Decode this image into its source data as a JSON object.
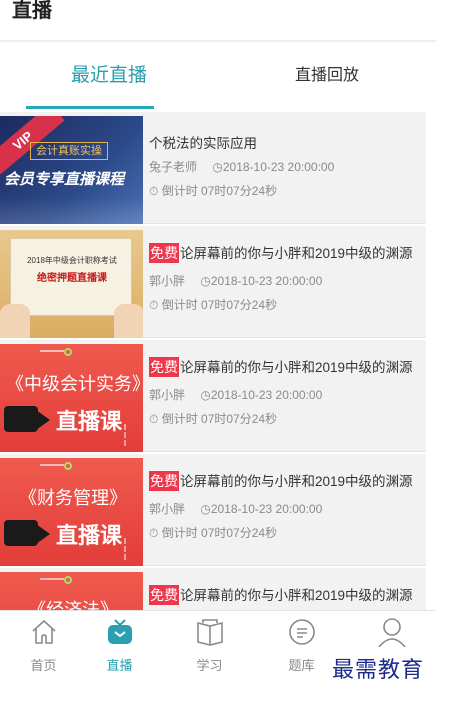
{
  "header": {
    "title": "直播"
  },
  "tabs": [
    {
      "label": "最近直播",
      "active": true
    },
    {
      "label": "直播回放",
      "active": false
    }
  ],
  "colors": {
    "accent": "#2aa7b8",
    "free_tag": "#f0364a",
    "watermark": "#1a2a8c"
  },
  "courses": [
    {
      "thumbnail": {
        "ribbon": "VIP",
        "subtitle": "会计真账实操",
        "headline": "会员专享直播课程"
      },
      "free": false,
      "title": "个税法的实际应用",
      "teacher": "兔子老师",
      "time": "2018-10-23 20:00:00",
      "countdown": "倒计时 07时07分24秒"
    },
    {
      "thumbnail": {
        "line1": "2018年中级会计职称考试",
        "line2": "绝密押题直播课"
      },
      "free": true,
      "free_label": "免费",
      "title": "论屏幕前的你与小胖和2019中级的渊源",
      "teacher": "郭小胖",
      "time": "2018-10-23 20:00:00",
      "countdown": "倒计时 07时07分24秒"
    },
    {
      "thumbnail": {
        "line1": "《中级会计实务》",
        "line2": "直播课"
      },
      "free": true,
      "free_label": "免费",
      "title": "论屏幕前的你与小胖和2019中级的渊源",
      "teacher": "郭小胖",
      "time": "2018-10-23 20:00:00",
      "countdown": "倒计时 07时07分24秒"
    },
    {
      "thumbnail": {
        "line1": "《财务管理》",
        "line2": "直播课"
      },
      "free": true,
      "free_label": "免费",
      "title": "论屏幕前的你与小胖和2019中级的渊源",
      "teacher": "郭小胖",
      "time": "2018-10-23 20:00:00",
      "countdown": "倒计时 07时07分24秒"
    },
    {
      "thumbnail": {
        "line1": "《经济法》",
        "line2": ""
      },
      "free": true,
      "free_label": "免费",
      "title": "论屏幕前的你与小胖和2019中级的渊源",
      "teacher": "",
      "time": "",
      "countdown": ""
    }
  ],
  "bottom_nav": [
    {
      "label": "首页",
      "icon": "home-icon",
      "active": false
    },
    {
      "label": "直播",
      "icon": "tv-icon",
      "active": true
    },
    {
      "label": "学习",
      "icon": "book-icon",
      "active": false
    },
    {
      "label": "题库",
      "icon": "question-bank-icon",
      "active": false
    },
    {
      "label": "",
      "icon": "profile-icon",
      "active": false
    }
  ],
  "watermark": "最需教育"
}
